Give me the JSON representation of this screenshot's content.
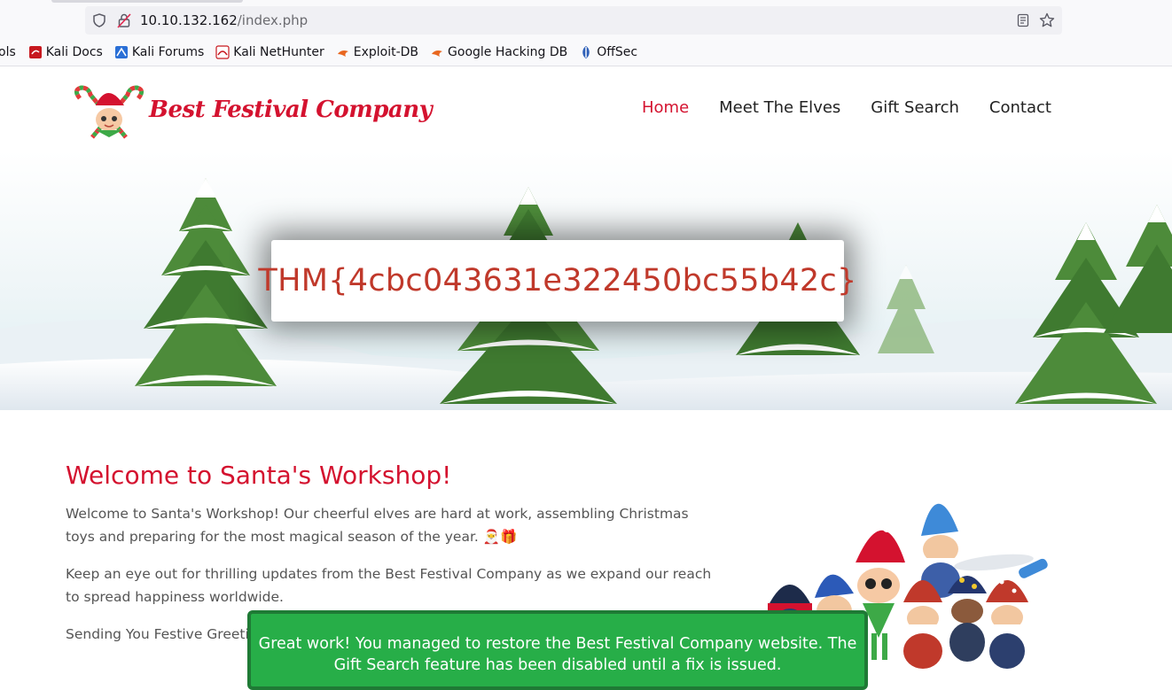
{
  "browser": {
    "url_host": "10.10.132.162",
    "url_path": "/index.php",
    "bookmarks": [
      {
        "label": "ols",
        "icon": "truncated-tools"
      },
      {
        "label": "Kali Docs",
        "icon": "kali-docs-icon"
      },
      {
        "label": "Kali Forums",
        "icon": "kali-forums-icon"
      },
      {
        "label": "Kali NetHunter",
        "icon": "kali-nethunter-icon"
      },
      {
        "label": "Exploit-DB",
        "icon": "exploit-db-icon"
      },
      {
        "label": "Google Hacking DB",
        "icon": "ghdb-icon"
      },
      {
        "label": "OffSec",
        "icon": "offsec-icon"
      }
    ]
  },
  "site": {
    "brand": "Best Festival Company",
    "nav": [
      "Home",
      "Meet The Elves",
      "Gift Search",
      "Contact"
    ],
    "active_nav": "Home",
    "accent_color": "#d4122f"
  },
  "hero": {
    "flag": "THM{4cbc043631e322450bc55b42c}"
  },
  "main": {
    "title": "Welcome to Santa's Workshop!",
    "para1": "Welcome to Santa's Workshop! Our cheerful elves are hard at work, assembling Christmas toys and preparing for the most magical season of the year. 🎅🎁",
    "para2": "Keep an eye out for thrilling updates from the Best Festival Company as we expand our reach to spread happiness worldwide.",
    "para3": "Sending You Festive Greetings"
  },
  "toast": {
    "message": "Great work! You managed to restore the Best Festival Company website. The Gift Search feature has been disabled until a fix is issued.",
    "color": "#27ae48"
  }
}
